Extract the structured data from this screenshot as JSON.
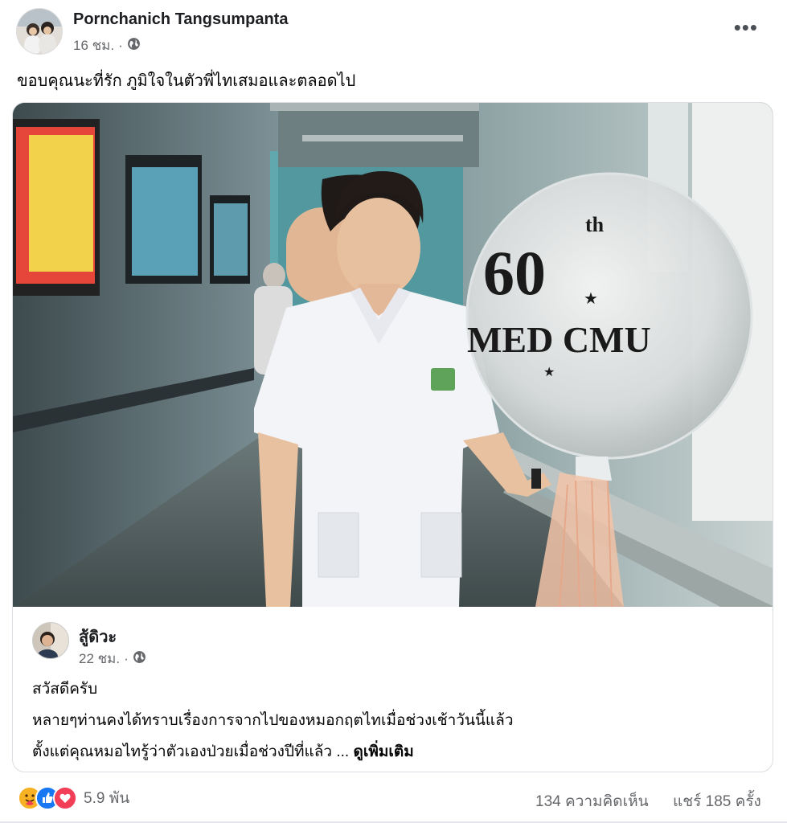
{
  "post": {
    "author": "Pornchanich Tangsumpanta",
    "time": "16 ชม.",
    "separator": "·",
    "caption": "ขอบคุณนะที่รัก ภูมิใจในตัวพี่ไทเสมอและตลอดไป",
    "more_menu": "•••"
  },
  "photo": {
    "balloon_line1": "60",
    "balloon_sup": "th",
    "balloon_line2": "MED CMU"
  },
  "shared": {
    "author": "สู้ดิวะ",
    "time": "22 ชม.",
    "separator": "·",
    "line1": "สวัสดีครับ",
    "line2": "หลายๆท่านคงได้ทราบเรื่องการจากไปของหมอกฤตไทเมื่อช่วงเช้าวันนี้แล้ว",
    "line3": "ตั้งแต่คุณหมอไทรู้ว่าตัวเองป่วยเมื่อช่วงปีที่แล้ว ...",
    "see_more": "ดูเพิ่มเติม"
  },
  "footer": {
    "reaction_count": "5.9 พัน",
    "comments": "134 ความคิดเห็น",
    "shares": "แชร์ 185 ครั้ง",
    "reaction_icons": [
      "care-icon",
      "like-icon",
      "love-icon"
    ]
  },
  "colors": {
    "text": "#050505",
    "secondary": "#65676b",
    "like_blue": "#1877f2",
    "love_red": "#f33e58",
    "care_yellow": "#f7b125"
  }
}
